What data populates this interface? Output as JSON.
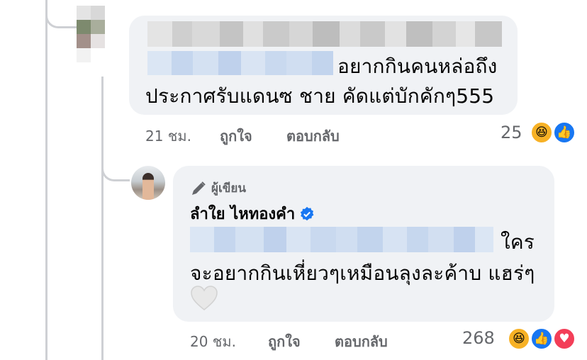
{
  "comment1": {
    "text_line1": "อยากกินคนหล่อถึง",
    "text_line2": "ประกาศรับแดนซ ชาย  คัดแต่บักคักๆ555",
    "time": "21 ชม.",
    "like_label": "ถูกใจ",
    "reply_label": "ตอบกลับ",
    "reaction_count": "25",
    "reactions": [
      "haha-icon",
      "like-icon"
    ]
  },
  "reply": {
    "author_badge": "ผู้เขียน",
    "author_name": "ลำใย ไหทองคำ",
    "text_line1": "ใคร",
    "text_line2": "จะอยากกินเหี่ยวๆเหมือนลุงละค้าบ แฮร่ๆ",
    "emoji": "white-heart-icon",
    "time": "20 ชม.",
    "like_label": "ถูกใจ",
    "reply_label": "ตอบกลับ",
    "reaction_count": "268",
    "reactions": [
      "haha-icon",
      "like-icon",
      "love-icon"
    ]
  },
  "colors": {
    "bubble": "#f0f2f5",
    "meta_text": "#65676b",
    "facebook_blue": "#1877f2",
    "thread_line": "#ced0d4"
  }
}
